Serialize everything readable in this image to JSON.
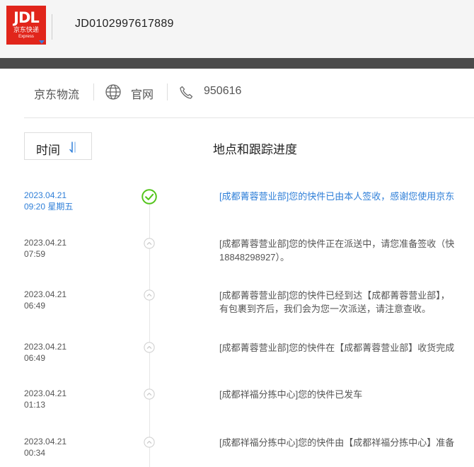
{
  "header": {
    "logo": {
      "brand": "JDL",
      "cn": "京东快递",
      "en": "Express"
    },
    "tracking_number": "JD0102997617889"
  },
  "info": {
    "company": "京东物流",
    "site_label": "官网",
    "phone": "950616",
    "icons": [
      "globe-icon",
      "phone-icon"
    ]
  },
  "table": {
    "sort_label": "时间",
    "column_title": "地点和跟踪进度"
  },
  "colors": {
    "brand": "#e1251b",
    "accent": "#2f7fd8",
    "done": "#52c41a"
  },
  "events": [
    {
      "date": "2023.04.21",
      "time": "09:20 星期五",
      "lines": [
        "[成都菁蓉营业部]您的快件已由本人签收，感谢您使用京东"
      ],
      "current": true
    },
    {
      "date": "2023.04.21",
      "time": "07:59",
      "lines": [
        "[成都菁蓉营业部]您的快件正在派送中，请您准备签收（快",
        "18848298927）。"
      ],
      "current": false
    },
    {
      "date": "2023.04.21",
      "time": "06:49",
      "lines": [
        "[成都菁蓉营业部]您的快件已经到达【成都菁蓉营业部】，",
        "有包裹到齐后，我们会为您一次派送，请注意查收。"
      ],
      "current": false
    },
    {
      "date": "2023.04.21",
      "time": "06:49",
      "lines": [
        "[成都菁蓉营业部]您的快件在【成都菁蓉营业部】收货完成"
      ],
      "current": false
    },
    {
      "date": "2023.04.21",
      "time": "01:13",
      "lines": [
        "[成都祥福分拣中心]您的快件已发车"
      ],
      "current": false
    },
    {
      "date": "2023.04.21",
      "time": "00:34",
      "lines": [
        "[成都祥福分拣中心]您的快件由【成都祥福分拣中心】准备"
      ],
      "current": false
    }
  ]
}
